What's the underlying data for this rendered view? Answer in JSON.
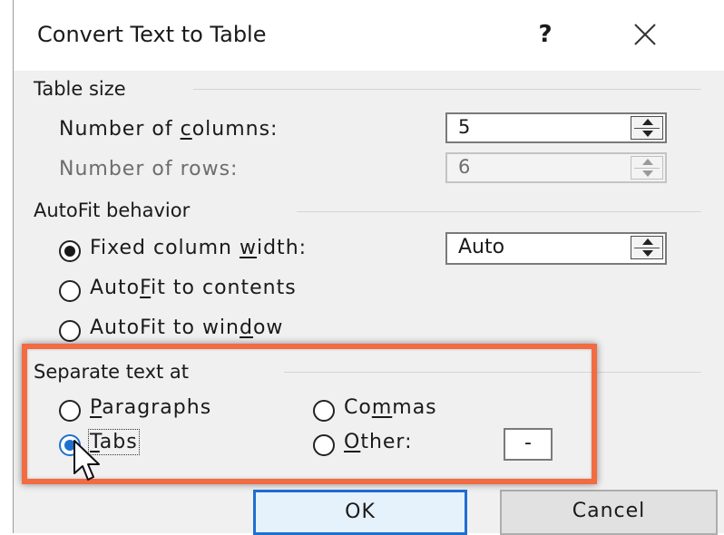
{
  "dialog": {
    "title": "Convert Text to Table",
    "help": "?",
    "close_icon": "close-x-icon"
  },
  "table_size": {
    "label": "Table size",
    "columns": {
      "label_pre": "Number of ",
      "label_mn": "c",
      "label_post": "olumns:",
      "value": "5"
    },
    "rows": {
      "label": "Number of rows:",
      "value": "6"
    }
  },
  "autofit": {
    "label": "AutoFit behavior",
    "fixed": {
      "pre": "Fixed column ",
      "mn": "w",
      "post": "idth:",
      "value": "Auto",
      "checked": true
    },
    "contents": {
      "pre": "Auto",
      "mn": "F",
      "post": "it to contents",
      "checked": false
    },
    "window": {
      "pre": "AutoFit to win",
      "mn": "d",
      "post": "ow",
      "checked": false
    }
  },
  "separate": {
    "label": "Separate text at",
    "paragraphs": {
      "pre": "",
      "mn": "P",
      "post": "aragraphs",
      "checked": false
    },
    "commas": {
      "pre": "Co",
      "mn": "m",
      "post": "mas",
      "checked": false
    },
    "tabs": {
      "pre": "",
      "mn": "T",
      "post": "abs",
      "checked": true
    },
    "other": {
      "pre": "",
      "mn": "O",
      "post": "ther:",
      "value": "-",
      "checked": false
    }
  },
  "buttons": {
    "ok": "OK",
    "cancel": "Cancel"
  },
  "colors": {
    "highlight": "#f26b43",
    "accent": "#1f6fd1",
    "dialog_bg": "#f0f0f0"
  },
  "icons": {
    "spinner": "spin-up-down-icon",
    "cursor": "mouse-pointer-icon"
  }
}
